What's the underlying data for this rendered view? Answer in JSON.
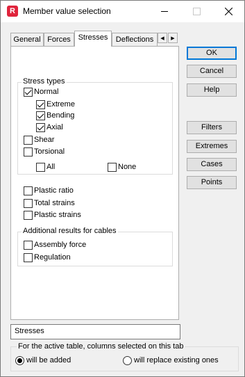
{
  "window": {
    "title": "Member value selection",
    "app_icon_letter": "R",
    "minimize_icon": "minimize-icon",
    "maximize_icon": "maximize-icon",
    "close_icon": "close-icon"
  },
  "tabs": [
    {
      "label": "General",
      "active": false
    },
    {
      "label": "Forces",
      "active": false
    },
    {
      "label": "Stresses",
      "active": true
    },
    {
      "label": "Deflections",
      "active": false
    }
  ],
  "stress_types": {
    "group_label": "Stress types",
    "normal": {
      "label": "Normal",
      "checked": true
    },
    "extreme": {
      "label": "Extreme",
      "checked": true
    },
    "bending": {
      "label": "Bending",
      "checked": true
    },
    "axial": {
      "label": "Axial",
      "checked": true
    },
    "shear": {
      "label": "Shear",
      "checked": false
    },
    "torsional": {
      "label": "Torsional",
      "checked": false
    },
    "all": {
      "label": "All",
      "checked": false
    },
    "none": {
      "label": "None",
      "checked": false
    }
  },
  "plastic": {
    "ratio": {
      "label": "Plastic ratio",
      "checked": false
    },
    "total_strains": {
      "label": "Total strains",
      "checked": false
    },
    "plastic_strains": {
      "label": "Plastic strains",
      "checked": false
    }
  },
  "cables": {
    "group_label": "Additional results for cables",
    "assembly_force": {
      "label": "Assembly force",
      "checked": false
    },
    "regulation": {
      "label": "Regulation",
      "checked": false
    }
  },
  "buttons": {
    "ok": "OK",
    "cancel": "Cancel",
    "help": "Help",
    "filters": "Filters",
    "extremes": "Extremes",
    "cases": "Cases",
    "points": "Points"
  },
  "selection_text": "Stresses",
  "active_table": {
    "group_label": "For the active table, columns selected on this tab",
    "will_be_added": {
      "label": "will be added",
      "selected": true
    },
    "will_replace": {
      "label": "will replace existing ones",
      "selected": false
    }
  }
}
